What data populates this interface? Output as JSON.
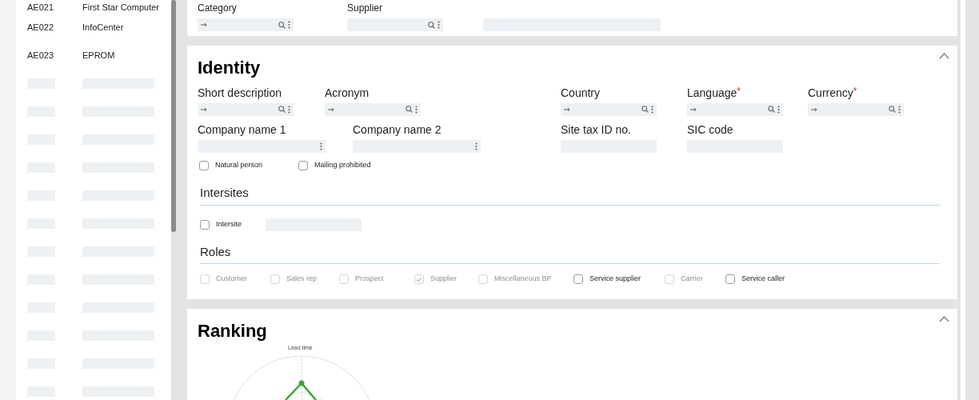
{
  "sidebar": {
    "rows": [
      {
        "code": "AE021",
        "name": "First Star Computer"
      },
      {
        "code": "AE022",
        "name": "InfoCenter"
      },
      {
        "code": "AE023",
        "name": "EPROM"
      }
    ]
  },
  "top_card": {
    "fields": [
      {
        "label": "Category",
        "kind": "lookup"
      },
      {
        "label": "Supplier",
        "kind": "search"
      },
      {
        "kind": "plain"
      }
    ]
  },
  "identity": {
    "title": "Identity",
    "expanded": true,
    "row_1": [
      {
        "label": "Short description",
        "kind": "lookup"
      },
      {
        "label": "Acronym",
        "kind": "lookup"
      },
      {
        "label": "Country",
        "kind": "lookup"
      },
      {
        "label": "Language",
        "kind": "lookup",
        "required_mark": "*"
      },
      {
        "label": "Currency",
        "kind": "lookup",
        "required_mark": "*"
      }
    ],
    "row_2": [
      {
        "label": "Company name 1",
        "kind": "menu"
      },
      {
        "label": "Company name 2",
        "kind": "menu"
      },
      {
        "label": "Site tax ID no.",
        "kind": "plain"
      },
      {
        "label": "SIC code",
        "kind": "plain"
      }
    ],
    "options": [
      {
        "label": "Natural person",
        "checked": false,
        "disabled": false
      },
      {
        "label": "Mailing prohibited",
        "checked": false,
        "disabled": false
      }
    ],
    "intersites": {
      "title": "Intersites",
      "checkbox": {
        "label": "Intersite",
        "checked": false,
        "disabled": false
      }
    },
    "roles": {
      "title": "Roles",
      "items": [
        {
          "label": "Customer",
          "checked": false,
          "disabled": true
        },
        {
          "label": "Sales rep",
          "checked": false,
          "disabled": true
        },
        {
          "label": "Prospect",
          "checked": false,
          "disabled": true
        },
        {
          "label": "Supplier",
          "checked": true,
          "disabled": true
        },
        {
          "label": "Miscellaneous BP",
          "checked": false,
          "disabled": true
        },
        {
          "label": "Service supplier",
          "checked": false,
          "disabled": false
        },
        {
          "label": "Carrier",
          "checked": false,
          "disabled": true
        },
        {
          "label": "Service caller",
          "checked": false,
          "disabled": false
        }
      ]
    }
  },
  "ranking": {
    "title": "Ranking",
    "expanded": true,
    "chart": {
      "axis_label": "Lead time"
    }
  }
}
